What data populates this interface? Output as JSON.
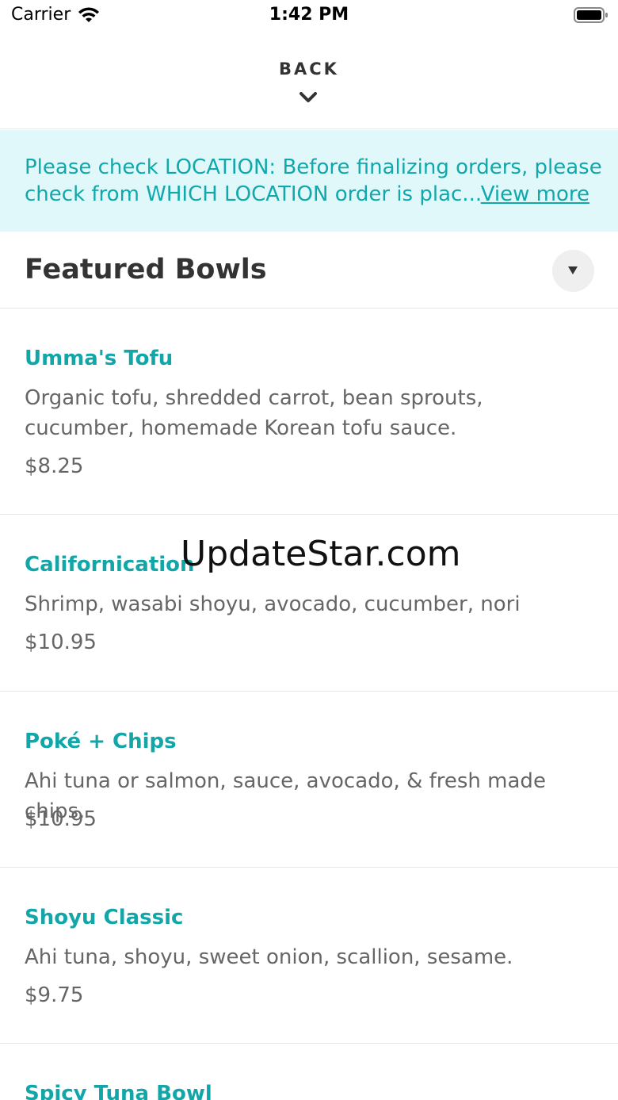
{
  "status_bar": {
    "carrier": "Carrier",
    "time": "1:42 PM"
  },
  "header": {
    "back_label": "BACK"
  },
  "notice": {
    "line1": "Please check LOCATION: Before finalizing orders, please",
    "line2": "check from WHICH LOCATION order is plac...",
    "link": "View more",
    "background": "#e0f8fa",
    "text_color": "#10a8ab"
  },
  "category": {
    "title": "Featured Bowls"
  },
  "items": [
    {
      "name": "Umma's Tofu",
      "description": "Organic tofu, shredded carrot, bean sprouts, cucumber, homemade Korean tofu sauce.",
      "price": "$8.25"
    },
    {
      "name": "Californication",
      "description": "Shrimp, wasabi shoyu, avocado, cucumber, nori",
      "price": "$10.95"
    },
    {
      "name": "Poké + Chips",
      "description": "Ahi tuna or salmon, sauce, avocado, & fresh made chips.",
      "price": "$10.95"
    },
    {
      "name": "Shoyu Classic",
      "description": "Ahi tuna, shoyu, sweet onion, scallion, sesame.",
      "price": "$9.75"
    },
    {
      "name": "Spicy Tuna Bowl"
    }
  ],
  "watermark": "UpdateStar.com",
  "colors": {
    "accent": "#12a6a8",
    "body_text": "#666666",
    "title_text": "#333333"
  }
}
